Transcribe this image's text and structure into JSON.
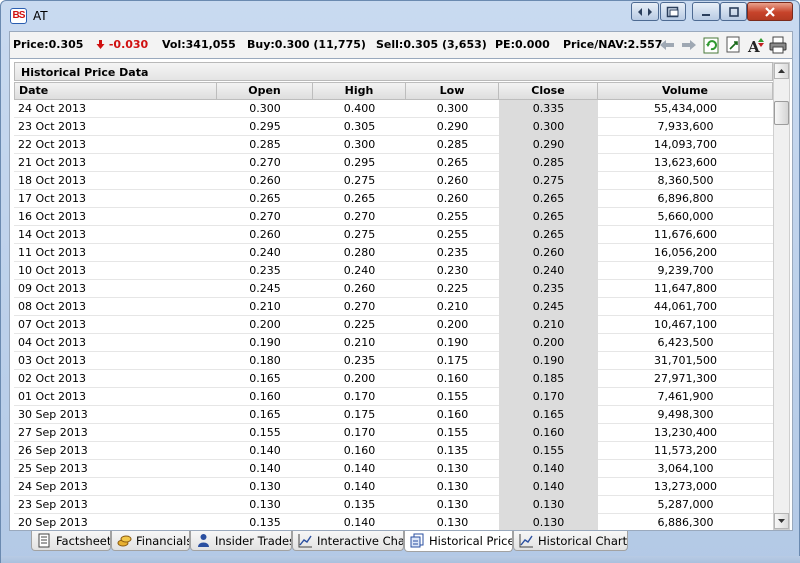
{
  "window": {
    "title": "AT",
    "icon_text": "BS"
  },
  "infobar": {
    "price": "Price:0.305",
    "change": "-0.030",
    "vol": "Vol:341,055",
    "buy": "Buy:0.300 (11,775)",
    "sell": "Sell:0.305 (3,653)",
    "pe": "PE:0.000",
    "price_nav": "Price/NAV:2.557"
  },
  "colors": {
    "negative": "#d01010",
    "close_column_bg": "#dcdcdc",
    "frame": "#b3c9e6"
  },
  "table": {
    "title": "Historical Price Data",
    "columns": [
      "Date",
      "Open",
      "High",
      "Low",
      "Close",
      "Volume"
    ],
    "rows": [
      [
        "24 Oct 2013",
        "0.300",
        "0.400",
        "0.300",
        "0.335",
        "55,434,000"
      ],
      [
        "23 Oct 2013",
        "0.295",
        "0.305",
        "0.290",
        "0.300",
        "7,933,600"
      ],
      [
        "22 Oct 2013",
        "0.285",
        "0.300",
        "0.285",
        "0.290",
        "14,093,700"
      ],
      [
        "21 Oct 2013",
        "0.270",
        "0.295",
        "0.265",
        "0.285",
        "13,623,600"
      ],
      [
        "18 Oct 2013",
        "0.260",
        "0.275",
        "0.260",
        "0.275",
        "8,360,500"
      ],
      [
        "17 Oct 2013",
        "0.265",
        "0.265",
        "0.260",
        "0.265",
        "6,896,800"
      ],
      [
        "16 Oct 2013",
        "0.270",
        "0.270",
        "0.255",
        "0.265",
        "5,660,000"
      ],
      [
        "14 Oct 2013",
        "0.260",
        "0.275",
        "0.255",
        "0.265",
        "11,676,600"
      ],
      [
        "11 Oct 2013",
        "0.240",
        "0.280",
        "0.235",
        "0.260",
        "16,056,200"
      ],
      [
        "10 Oct 2013",
        "0.235",
        "0.240",
        "0.230",
        "0.240",
        "9,239,700"
      ],
      [
        "09 Oct 2013",
        "0.245",
        "0.260",
        "0.225",
        "0.235",
        "11,647,800"
      ],
      [
        "08 Oct 2013",
        "0.210",
        "0.270",
        "0.210",
        "0.245",
        "44,061,700"
      ],
      [
        "07 Oct 2013",
        "0.200",
        "0.225",
        "0.200",
        "0.210",
        "10,467,100"
      ],
      [
        "04 Oct 2013",
        "0.190",
        "0.210",
        "0.190",
        "0.200",
        "6,423,500"
      ],
      [
        "03 Oct 2013",
        "0.180",
        "0.235",
        "0.175",
        "0.190",
        "31,701,500"
      ],
      [
        "02 Oct 2013",
        "0.165",
        "0.200",
        "0.160",
        "0.185",
        "27,971,300"
      ],
      [
        "01 Oct 2013",
        "0.160",
        "0.170",
        "0.155",
        "0.170",
        "7,461,900"
      ],
      [
        "30 Sep 2013",
        "0.165",
        "0.175",
        "0.160",
        "0.165",
        "9,498,300"
      ],
      [
        "27 Sep 2013",
        "0.155",
        "0.170",
        "0.155",
        "0.160",
        "13,230,400"
      ],
      [
        "26 Sep 2013",
        "0.140",
        "0.160",
        "0.135",
        "0.155",
        "11,573,200"
      ],
      [
        "25 Sep 2013",
        "0.140",
        "0.140",
        "0.130",
        "0.140",
        "3,064,100"
      ],
      [
        "24 Sep 2013",
        "0.130",
        "0.140",
        "0.130",
        "0.140",
        "13,273,000"
      ],
      [
        "23 Sep 2013",
        "0.130",
        "0.135",
        "0.130",
        "0.130",
        "5,287,000"
      ],
      [
        "20 Sep 2013",
        "0.135",
        "0.140",
        "0.130",
        "0.130",
        "6,886,300"
      ]
    ]
  },
  "tabs": [
    {
      "label": "Factsheet",
      "icon": "document-icon",
      "active": false
    },
    {
      "label": "Financials",
      "icon": "coins-icon",
      "active": false
    },
    {
      "label": "Insider Trades",
      "icon": "person-icon",
      "active": false
    },
    {
      "label": "Interactive Chart",
      "icon": "line-chart-icon",
      "active": false
    },
    {
      "label": "Historical Price",
      "icon": "price-pages-icon",
      "active": true
    },
    {
      "label": "Historical Charts",
      "icon": "line-chart-icon",
      "active": false
    }
  ]
}
